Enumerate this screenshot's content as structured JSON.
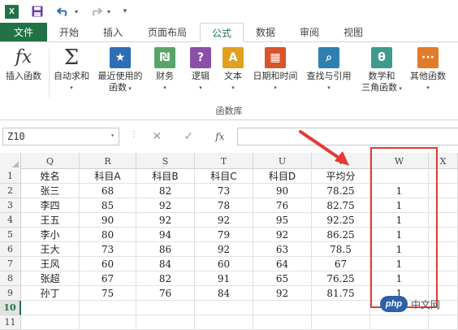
{
  "qat": {
    "logo_text": "X",
    "more": "▾"
  },
  "tabs": [
    {
      "label": "文件",
      "kind": "file"
    },
    {
      "label": "开始"
    },
    {
      "label": "插入"
    },
    {
      "label": "页面布局"
    },
    {
      "label": "公式",
      "active": true
    },
    {
      "label": "数据"
    },
    {
      "label": "审阅"
    },
    {
      "label": "视图"
    }
  ],
  "ribbon": {
    "group_label": "函数库",
    "buttons": [
      {
        "name": "insert-function",
        "label": "插入函数",
        "icon": "fx-icon",
        "glyph": "fx",
        "color": "#3a3a3a"
      },
      {
        "name": "autosum",
        "label": "自动求和",
        "label2": "",
        "caret": true,
        "icon": "sigma-icon",
        "glyph": "Σ",
        "color": "#3a3a3a"
      },
      {
        "name": "recently-used",
        "label": "最近使用的",
        "label2": "函数",
        "caret": true,
        "icon": "star-icon",
        "glyph": "★",
        "color": "#2f6db5"
      },
      {
        "name": "financial",
        "label": "财务",
        "caret": true,
        "icon": "coins-icon",
        "glyph": "₪",
        "color": "#5aa469"
      },
      {
        "name": "logical",
        "label": "逻辑",
        "caret": true,
        "icon": "question-icon",
        "glyph": "?",
        "color": "#8a4fa7"
      },
      {
        "name": "text",
        "label": "文本",
        "caret": true,
        "icon": "text-a-icon",
        "glyph": "A",
        "color": "#e0a020"
      },
      {
        "name": "date-time",
        "label": "日期和时间",
        "caret": true,
        "icon": "calendar-icon",
        "glyph": "▦",
        "color": "#d9532b"
      },
      {
        "name": "lookup",
        "label": "查找与引用",
        "caret": true,
        "icon": "magnifier-icon",
        "glyph": "⌕",
        "color": "#2f7fb0"
      },
      {
        "name": "math-trig",
        "label": "数学和",
        "label2": "三角函数",
        "caret": true,
        "icon": "theta-icon",
        "glyph": "θ",
        "color": "#3d9a8c"
      },
      {
        "name": "more-functions",
        "label": "其他函数",
        "caret": true,
        "icon": "more-icon",
        "glyph": "···",
        "color": "#e07b2a"
      }
    ]
  },
  "formula_bar": {
    "name_box": "Z10",
    "cancel": "✕",
    "enter": "✓",
    "fx": "fx"
  },
  "grid": {
    "columns": [
      "Q",
      "R",
      "S",
      "T",
      "U",
      "V",
      "W",
      "X"
    ],
    "row_headers": [
      "1",
      "2",
      "3",
      "4",
      "5",
      "6",
      "7",
      "8",
      "9",
      "10",
      "11"
    ],
    "active_row": "10",
    "header": [
      "姓名",
      "科目A",
      "科目B",
      "科目C",
      "科目D",
      "平均分",
      ""
    ],
    "rows": [
      [
        "张三",
        "68",
        "82",
        "73",
        "90",
        "78.25",
        "1"
      ],
      [
        "李四",
        "85",
        "92",
        "78",
        "76",
        "82.75",
        "1"
      ],
      [
        "王五",
        "90",
        "92",
        "92",
        "95",
        "92.25",
        "1"
      ],
      [
        "李小",
        "80",
        "94",
        "79",
        "92",
        "86.25",
        "1"
      ],
      [
        "王大",
        "73",
        "86",
        "92",
        "63",
        "78.5",
        "1"
      ],
      [
        "王风",
        "60",
        "84",
        "60",
        "64",
        "67",
        "1"
      ],
      [
        "张超",
        "67",
        "82",
        "91",
        "65",
        "76.25",
        "1"
      ],
      [
        "孙丁",
        "75",
        "76",
        "84",
        "92",
        "81.75",
        "1"
      ]
    ]
  },
  "watermark": {
    "logo": "php",
    "text": "中文网"
  },
  "colors": {
    "brand": "#217346",
    "annotation": "#e53935"
  }
}
